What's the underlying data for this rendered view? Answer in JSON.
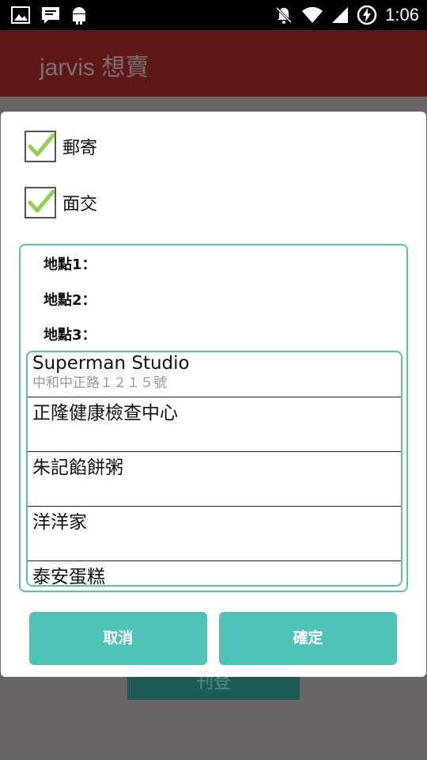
{
  "status_bar": {
    "time": "1:06",
    "icons_left": [
      "image-icon",
      "message-icon",
      "android-icon"
    ],
    "icons_right": [
      "notifications-off-icon",
      "wifi-icon",
      "signal-icon",
      "battery-charging-icon"
    ]
  },
  "app_bar": {
    "title": "jarvis 想賣"
  },
  "background": {
    "button_label": "刊登"
  },
  "dialog": {
    "options": [
      {
        "label": "郵寄",
        "checked": true
      },
      {
        "label": "面交",
        "checked": true
      }
    ],
    "locations": [
      {
        "label": "地點1："
      },
      {
        "label": "地點2："
      },
      {
        "label": "地點3："
      }
    ],
    "places": [
      {
        "name": "Superman Studio",
        "address": "中和中正路１２１５號"
      },
      {
        "name": "正隆健康檢查中心",
        "address": ""
      },
      {
        "name": "朱記餡餅粥",
        "address": ""
      },
      {
        "name": "洋洋家",
        "address": ""
      },
      {
        "name": "泰安蛋糕",
        "address": ""
      }
    ],
    "cancel_label": "取消",
    "confirm_label": "確定"
  },
  "colors": {
    "accent": "#4fc3b6",
    "app_bar": "#5e1916",
    "scrim": "#6b6464"
  }
}
